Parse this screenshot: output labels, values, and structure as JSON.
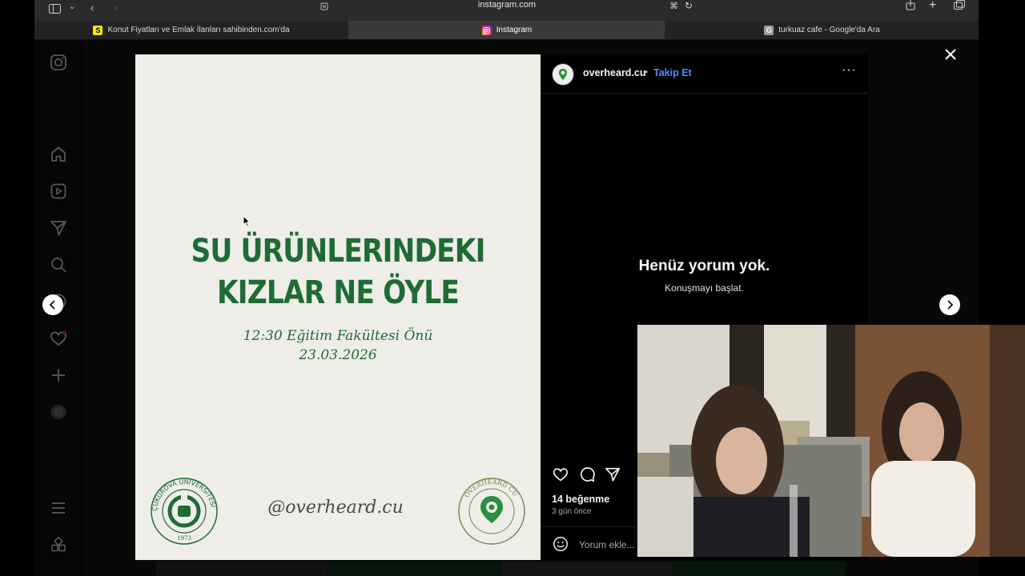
{
  "browser": {
    "url": "instagram.com",
    "tabs": [
      {
        "label": "Konut Fiyatları ve Emlak İlanları sahibinden.com'da",
        "favicon": "S",
        "favicon_color": "#ffe800",
        "active": false
      },
      {
        "label": "Instagram",
        "favicon": "instagram-icon",
        "active": true
      },
      {
        "label": "turkuaz cafe - Google'da Ara",
        "favicon": "G",
        "favicon_color": "#9a9a9a",
        "active": false
      }
    ]
  },
  "sidebar": {
    "items": [
      "instagram-logo",
      "home",
      "reels",
      "messages",
      "search",
      "explore",
      "notifications",
      "create",
      "profile",
      "more",
      "also-from-meta"
    ]
  },
  "post": {
    "image": {
      "headline_line1": "SU ÜRÜNLERINDEKI",
      "headline_line2": "KIZLAR NE ÖYLE",
      "subline1": "12:30 Eğitim Fakültesi Önü",
      "subline2": "23.03.2026",
      "handle": "@overheard.cu",
      "left_seal_text": "ÇUKUROVA ÜNİVERSİTESİ",
      "left_seal_year": "1973",
      "right_seal_text": "OVERHEARD CU",
      "brand_green": "#1f6b35"
    },
    "author": "overheard.cu",
    "separator": "•",
    "follow_label": "Takip Et",
    "more_label": "···",
    "no_comments_title": "Henüz yorum yok.",
    "no_comments_subtitle": "Konuşmayı başlat.",
    "likes": "14 beğenme",
    "time_ago": "3 gün önce",
    "comment_placeholder": "Yorum ekle...",
    "accent": "#4f8cff"
  }
}
